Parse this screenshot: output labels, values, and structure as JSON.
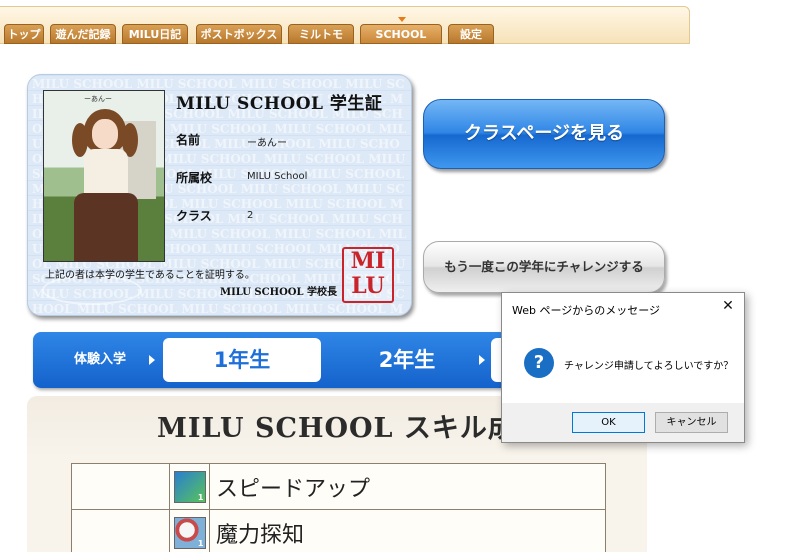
{
  "nav": {
    "tabs": [
      {
        "label": "トップ"
      },
      {
        "label": "遊んだ記録"
      },
      {
        "label": "MILU日記"
      },
      {
        "label": "ポストボックス"
      },
      {
        "label": "ミルトモ"
      },
      {
        "label": "SCHOOL"
      },
      {
        "label": "設定"
      }
    ],
    "active_tab": "SCHOOL"
  },
  "student_card": {
    "title": "MILU SCHOOL 学生証",
    "avatar_tag": "ーあんー",
    "fields": [
      {
        "label": "名前",
        "value": "ーあんー"
      },
      {
        "label": "所属校",
        "value": "MILU School"
      },
      {
        "label": "クラス",
        "value": "2"
      }
    ],
    "certification": "上記の者は本学の学生であることを証明する。",
    "principal": "MILU SCHOOL 学校長",
    "seal": "MILU"
  },
  "buttons": {
    "class_page": "クラスページを見る",
    "retry": "もう一度この学年にチャレンジする"
  },
  "grade_nav": {
    "trial": "体験入学",
    "year1": "1年生",
    "year2": "2年生"
  },
  "skills": {
    "title": "MILU SCHOOL スキル成績",
    "rows": [
      {
        "icon": "speed-up-icon",
        "name": "スピードアップ"
      },
      {
        "icon": "magic-detect-icon",
        "name": "魔力探知"
      }
    ]
  },
  "dialog": {
    "title": "Web ページからのメッセージ",
    "message": "チャレンジ申請してよろしいですか？",
    "ok": "OK",
    "cancel": "キャンセル"
  }
}
